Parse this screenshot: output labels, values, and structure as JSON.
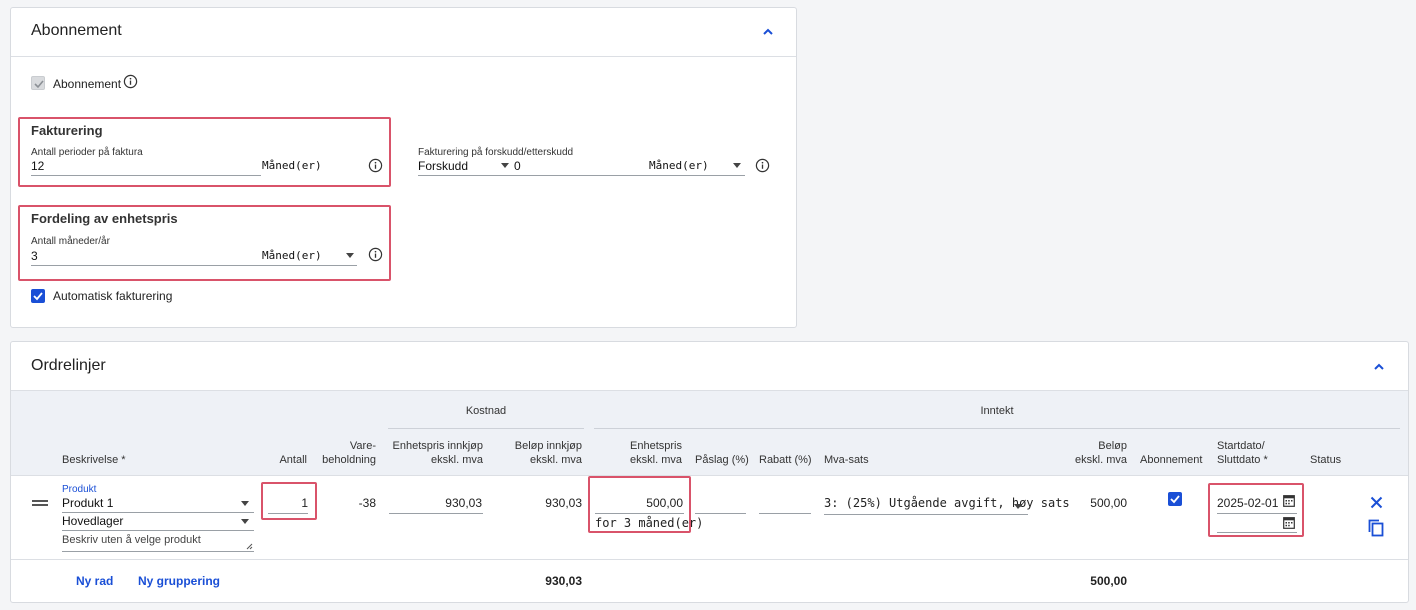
{
  "subscription_panel": {
    "title": "Abonnement",
    "subscription_checkbox_label": "Abonnement",
    "invoicing": {
      "heading": "Fakturering",
      "periods_label": "Antall perioder på faktura",
      "periods_value": "12",
      "periods_unit": "Måned(er)",
      "advance_label": "Fakturering på forskudd/etterskudd",
      "advance_value": "Forskudd",
      "advance_amount": "0",
      "advance_unit": "Måned(er)"
    },
    "unit_price_distribution": {
      "heading": "Fordeling av enhetspris",
      "months_label": "Antall måneder/år",
      "months_value": "3",
      "months_unit": "Måned(er)"
    },
    "auto_invoicing_label": "Automatisk fakturering"
  },
  "order_lines": {
    "title": "Ordrelinjer",
    "group_headers": {
      "cost": "Kostnad",
      "income": "Inntekt"
    },
    "columns": {
      "description": "Beskrivelse *",
      "quantity": "Antall",
      "stock_1": "Vare-",
      "stock_2": "beholdning",
      "unit_cost_1": "Enhetspris innkjøp",
      "unit_cost_2": "ekskl. mva",
      "cost_amount_1": "Beløp innkjøp",
      "cost_amount_2": "ekskl. mva",
      "unit_price_1": "Enhetspris",
      "unit_price_2": "ekskl. mva",
      "markup": "Påslag (%)",
      "discount": "Rabatt (%)",
      "vat": "Mva-sats",
      "amount_1": "Beløp",
      "amount_2": "ekskl. mva",
      "subscription": "Abonnement",
      "dates_1": "Startdato/",
      "dates_2": "Sluttdato *",
      "status": "Status"
    },
    "row": {
      "product_label": "Produkt",
      "product_value": "Produkt 1",
      "warehouse_value": "Hovedlager",
      "description_placeholder": "Beskriv uten å velge produkt",
      "quantity": "1",
      "stock": "-38",
      "unit_cost": "930,03",
      "cost_amount": "930,03",
      "unit_price": "500,00",
      "unit_price_note": "for 3 måned(er)",
      "vat": "3: (25%) Utgående avgift, høy sats",
      "amount": "500,00",
      "start_date": "2025-02-01"
    },
    "footer": {
      "new_row": "Ny rad",
      "new_group": "Ny gruppering",
      "cost_total": "930,03",
      "amount_total": "500,00"
    }
  },
  "colors": {
    "accent": "#1a4fd6",
    "highlight": "#d9536a"
  }
}
